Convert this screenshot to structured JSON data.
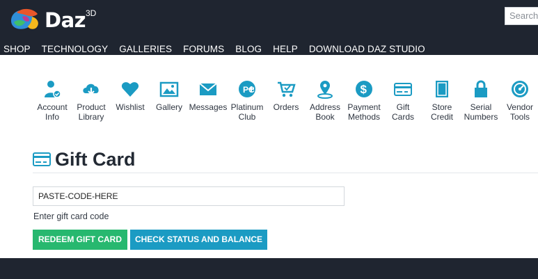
{
  "header": {
    "brand": "Daz",
    "brand_superscript": "3D",
    "search_placeholder": "Search",
    "nav": [
      "SHOP",
      "TECHNOLOGY",
      "GALLERIES",
      "FORUMS",
      "BLOG",
      "HELP",
      "DOWNLOAD DAZ STUDIO"
    ]
  },
  "account_nav": {
    "icon_color": "#1b9bc3",
    "items": [
      {
        "label": "Account Info",
        "icon": "account-info-icon"
      },
      {
        "label": "Product Library",
        "icon": "product-library-icon"
      },
      {
        "label": "Wishlist",
        "icon": "heart-icon"
      },
      {
        "label": "Gallery",
        "icon": "gallery-icon"
      },
      {
        "label": "Messages",
        "icon": "envelope-icon"
      },
      {
        "label": "Platinum Club",
        "icon": "platinum-club-icon"
      },
      {
        "label": "Orders",
        "icon": "cart-icon"
      },
      {
        "label": "Address Book",
        "icon": "map-pin-icon"
      },
      {
        "label": "Payment Methods",
        "icon": "dollar-icon"
      },
      {
        "label": "Gift Cards",
        "icon": "credit-card-icon"
      },
      {
        "label": "Store Credit",
        "icon": "book-icon"
      },
      {
        "label": "Serial Numbers",
        "icon": "lock-icon"
      },
      {
        "label": "Vendor Tools",
        "icon": "gauge-icon"
      }
    ]
  },
  "page": {
    "title": "Gift Card",
    "title_icon": "credit-card-icon",
    "code_input_value": "PASTE-CODE-HERE",
    "hint": "Enter gift card code",
    "redeem_label": "REDEEM GIFT CARD",
    "check_label": "CHECK STATUS AND BALANCE"
  },
  "colors": {
    "header_bg": "#1f2530",
    "accent": "#1b9bc3",
    "redeem": "#27b86f"
  }
}
